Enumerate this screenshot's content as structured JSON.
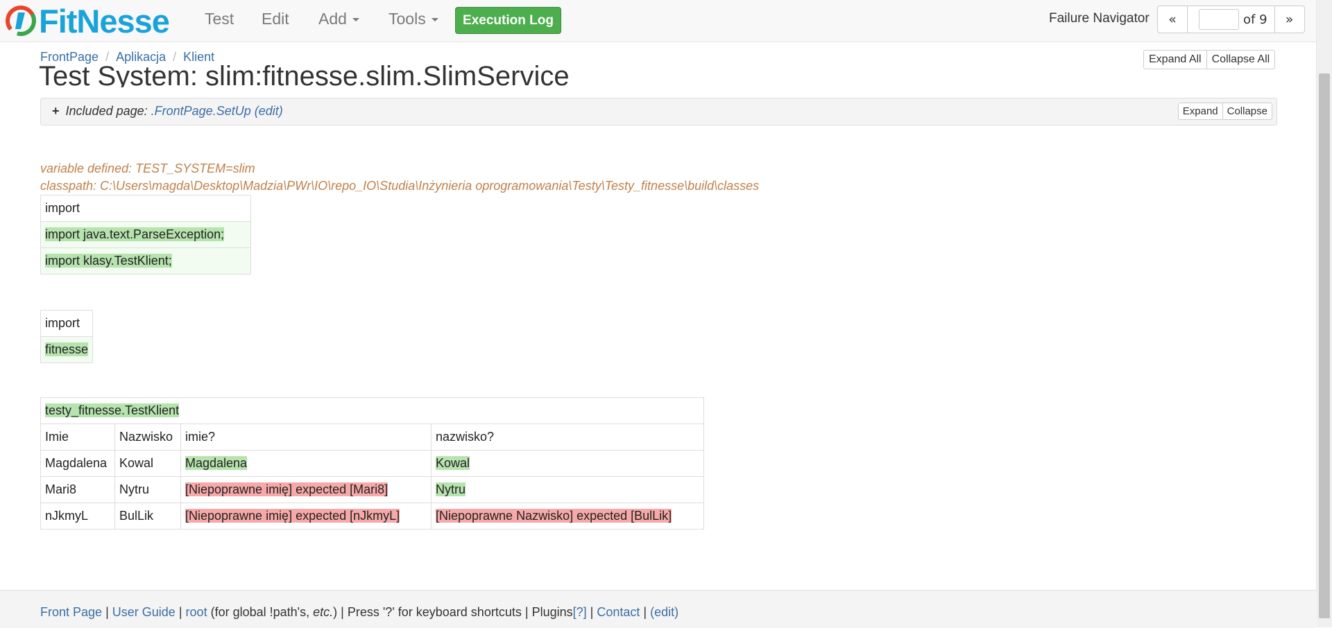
{
  "nav": {
    "logo": "FitNesse",
    "items": [
      "Test",
      "Edit",
      "Add",
      "Tools"
    ],
    "execution_log": "Execution Log",
    "failure_navigator": {
      "label": "Failure Navigator",
      "prev": "«",
      "next": "»",
      "page_value": "",
      "of": "of 9"
    }
  },
  "breadcrumb": [
    "FrontPage",
    "Aplikacja",
    "Klient"
  ],
  "expand_all": "Expand All",
  "collapse_all": "Collapse All",
  "page_title": "Test System: slim:fitnesse.slim.SlimService",
  "included": {
    "prefix": "Included page:",
    "page": ".FrontPage.SetUp",
    "edit": "(edit)",
    "expand": "Expand",
    "collapse": "Collapse"
  },
  "variable_line": "variable defined: TEST_SYSTEM=slim",
  "classpath_line": "classpath: C:\\Users\\magda\\Desktop\\Madzia\\PWr\\IO\\repo_IO\\Studia\\Inżynieria oprogramowania\\Testy\\Testy_fitnesse\\build\\classes",
  "import_table_1": {
    "header": "import",
    "rows": [
      "import java.text.ParseException;",
      "import klasy.TestKlient;"
    ]
  },
  "import_table_2": {
    "header": "import",
    "rows": [
      "fitnesse"
    ]
  },
  "decision_table": {
    "fixture": "testy_fitnesse.TestKlient",
    "headers": [
      "Imie",
      "Nazwisko",
      "imie?",
      "nazwisko?"
    ],
    "rows": [
      [
        "Magdalena",
        "Kowal",
        "Magdalena",
        "Kowal"
      ],
      [
        "Mari8",
        "Nytru",
        "[Niepoprawne imię] expected [Mari8]",
        "Nytru"
      ],
      [
        "nJkmyL",
        "BulLik",
        "[Niepoprawne imię] expected [nJkmyL]",
        "[Niepoprawne Nazwisko] expected [BulLik]"
      ]
    ]
  },
  "footer": {
    "front_page": "Front Page",
    "sep": "|",
    "user_guide": "User Guide",
    "root": "root",
    "root_note": "(for global !path's,",
    "etc": "etc.",
    "close": ")",
    "shortcuts": "Press '?' for keyboard shortcuts",
    "plugins": "Plugins",
    "plugins_help": "[?]",
    "contact": "Contact",
    "edit": "(edit)"
  }
}
